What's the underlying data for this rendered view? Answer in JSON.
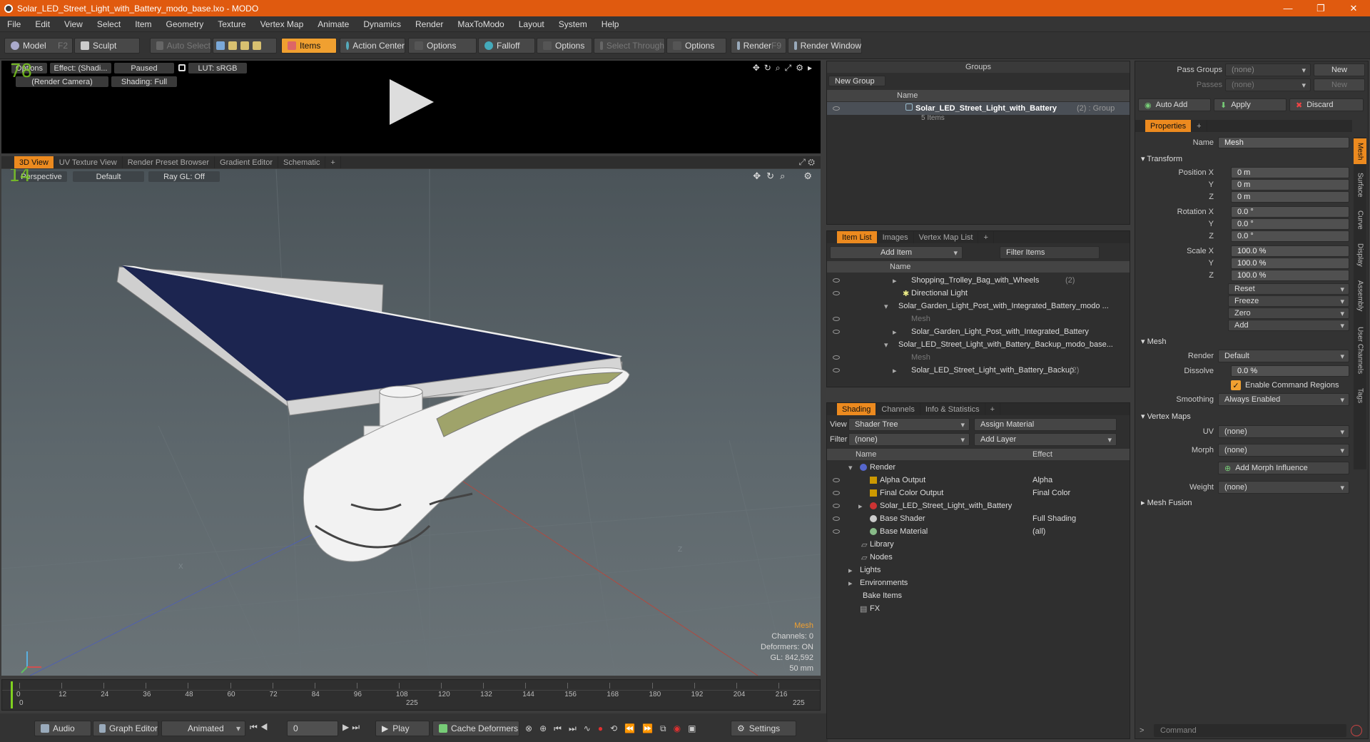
{
  "window": {
    "title": "Solar_LED_Street_Light_with_Battery_modo_base.lxo - MODO",
    "minimize": "—",
    "maximize": "❐",
    "close": "✕"
  },
  "menu": [
    "File",
    "Edit",
    "View",
    "Select",
    "Item",
    "Geometry",
    "Texture",
    "Vertex Map",
    "Animate",
    "Dynamics",
    "Render",
    "MaxToModo",
    "Layout",
    "System",
    "Help"
  ],
  "toolbar": {
    "model": "Model",
    "model_key": "F2",
    "sculpt": "Sculpt",
    "auto_select": "Auto Select",
    "items": "Items",
    "action_center": "Action Center",
    "options1": "Options",
    "falloff": "Falloff",
    "options2": "Options",
    "select_through": "Select Through",
    "options3": "Options",
    "render": "Render",
    "render_key": "F9",
    "render_window": "Render Window"
  },
  "preview": {
    "options": "Options",
    "effect": "Effect: (Shadi...",
    "paused": "Paused",
    "lut": "LUT: sRGB",
    "camera": "(Render Camera)",
    "shading": "Shading: Full",
    "counter": "78"
  },
  "view_tabs": [
    "3D View",
    "UV Texture View",
    "Render Preset Browser",
    "Gradient Editor",
    "Schematic",
    "+"
  ],
  "viewport": {
    "perspective": "Perspective",
    "default": "Default",
    "raygl": "Ray GL: Off",
    "counter": "14",
    "info_title": "Mesh",
    "channels": "Channels: 0",
    "deformers": "Deformers: ON",
    "gl": "GL: 842,592",
    "lens": "50 mm",
    "axis_x": "X",
    "axis_z": "Z"
  },
  "timeline": {
    "ticks": [
      "0",
      "12",
      "24",
      "36",
      "48",
      "60",
      "72",
      "84",
      "96",
      "108",
      "120",
      "132",
      "144",
      "156",
      "168",
      "180",
      "192",
      "204",
      "216"
    ],
    "start": "0",
    "mid": "225",
    "end": "225"
  },
  "bottom": {
    "audio": "Audio",
    "graph_editor": "Graph Editor",
    "animated": "Animated",
    "frame": "0",
    "play": "Play",
    "cache_deformers": "Cache Deformers",
    "settings": "Settings"
  },
  "groups": {
    "title": "Groups",
    "new_group": "New Group",
    "col_name": "Name",
    "item_name": "Solar_LED_Street_Light_with_Battery",
    "item_suffix": "(2) : Group",
    "item_count": "5 Items"
  },
  "itemlist": {
    "tabs": [
      "Item List",
      "Images",
      "Vertex Map List",
      "+"
    ],
    "add_item": "Add Item",
    "filter_items": "Filter Items",
    "col_name": "Name",
    "rows": [
      {
        "name": "Shopping_Trolley_Bag_with_Wheels",
        "suffix": "(2)"
      },
      {
        "name": "Directional Light",
        "suffix": ""
      },
      {
        "name": "Solar_Garden_Light_Post_with_Integrated_Battery_modo ...",
        "suffix": ""
      },
      {
        "name": "Mesh",
        "suffix": ""
      },
      {
        "name": "Solar_Garden_Light_Post_with_Integrated_Battery",
        "suffix": ""
      },
      {
        "name": "Solar_LED_Street_Light_with_Battery_Backup_modo_base...",
        "suffix": ""
      },
      {
        "name": "Mesh",
        "suffix": ""
      },
      {
        "name": "Solar_LED_Street_Light_with_Battery_Backup",
        "suffix": "(2)"
      }
    ]
  },
  "shading": {
    "tabs": [
      "Shading",
      "Channels",
      "Info & Statistics",
      "+"
    ],
    "view_label": "View",
    "view_value": "Shader Tree",
    "assign_material": "Assign Material",
    "filter_label": "Filter",
    "filter_value": "(none)",
    "add_layer": "Add Layer",
    "col_name": "Name",
    "col_effect": "Effect",
    "rows": [
      {
        "name": "Render",
        "effect": ""
      },
      {
        "name": "Alpha Output",
        "effect": "Alpha"
      },
      {
        "name": "Final Color Output",
        "effect": "Final Color"
      },
      {
        "name": "Solar_LED_Street_Light_with_Battery",
        "effect": ""
      },
      {
        "name": "Base Shader",
        "effect": "Full Shading"
      },
      {
        "name": "Base Material",
        "effect": "(all)"
      },
      {
        "name": "Library",
        "effect": ""
      },
      {
        "name": "Nodes",
        "effect": ""
      },
      {
        "name": "Lights",
        "effect": ""
      },
      {
        "name": "Environments",
        "effect": ""
      },
      {
        "name": "Bake Items",
        "effect": ""
      },
      {
        "name": "FX",
        "effect": ""
      }
    ]
  },
  "right": {
    "pass_groups": "Pass Groups",
    "passes": "Passes",
    "none1": "(none)",
    "none2": "(none)",
    "new1": "New",
    "new2": "New",
    "auto_add": "Auto Add",
    "apply": "Apply",
    "discard": "Discard",
    "properties": "Properties",
    "name_label": "Name",
    "name_value": "Mesh",
    "transform": "Transform",
    "position_x": "Position X",
    "y": "Y",
    "z": "Z",
    "pos": [
      "0 m",
      "0 m",
      "0 m"
    ],
    "rotation_x": "Rotation X",
    "rot": [
      "0.0 °",
      "0.0 °",
      "0.0 °"
    ],
    "scale_x": "Scale X",
    "scale": [
      "100.0 %",
      "100.0 %",
      "100.0 %"
    ],
    "reset": "Reset",
    "freeze": "Freeze",
    "zero": "Zero",
    "add": "Add",
    "mesh": "Mesh",
    "render_label": "Render",
    "render_value": "Default",
    "dissolve_label": "Dissolve",
    "dissolve_value": "0.0 %",
    "enable_cmd": "Enable Command Regions",
    "smoothing_label": "Smoothing",
    "smoothing_value": "Always Enabled",
    "vertex_maps": "Vertex Maps",
    "uv_label": "UV",
    "uv_value": "(none)",
    "morph_label": "Morph",
    "morph_value": "(none)",
    "add_morph": "Add Morph Influence",
    "weight_label": "Weight",
    "weight_value": "(none)",
    "mesh_fusion": "Mesh Fusion",
    "command": "Command",
    "side_tabs": [
      "Mesh",
      "Surface",
      "Curve",
      "Display",
      "Assembly",
      "User Channels",
      "Tags"
    ]
  }
}
